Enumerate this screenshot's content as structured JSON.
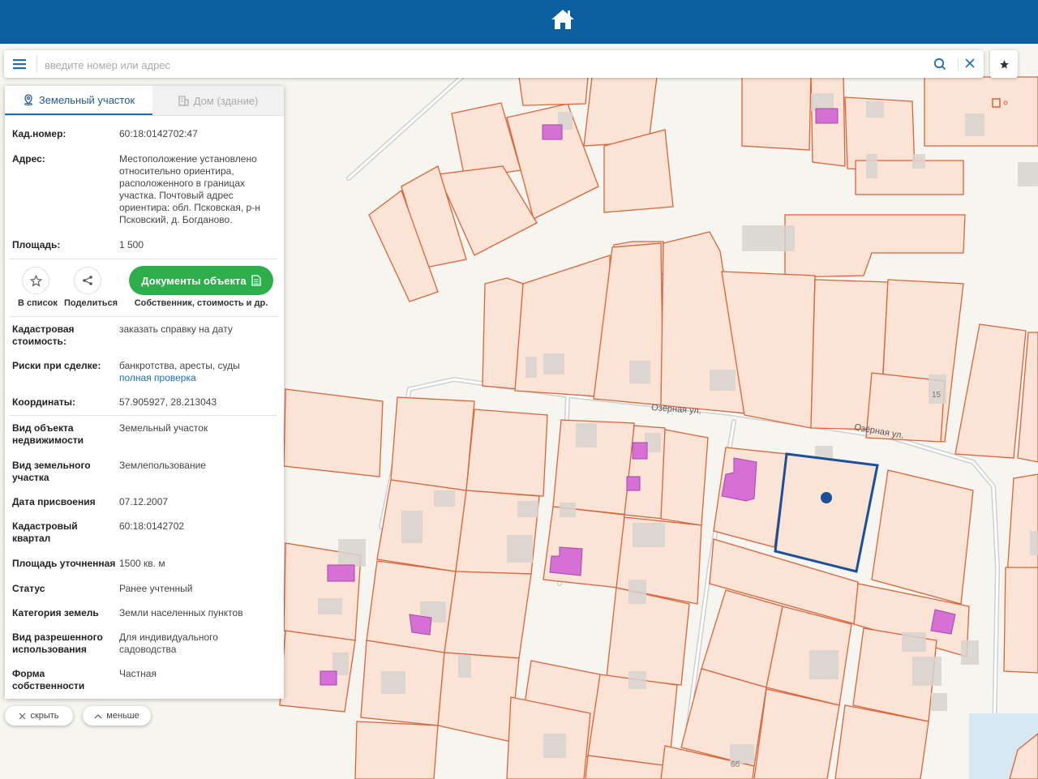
{
  "search": {
    "placeholder": "введите номер или адрес"
  },
  "tabs": {
    "land": "Земельный участок",
    "house": "Дом (здание)"
  },
  "parcel": {
    "cad_number_label": "Кад.номер:",
    "cad_number": "60:18:0142702:47",
    "address_label": "Адрес:",
    "address": "Местоположение установлено относительно ориентира, расположенного в границах участка. Почтовый адрес ориентира: обл. Псковская, р-н Псковский, д. Богданово.",
    "area_label": "Площадь:",
    "area": "1 500"
  },
  "actions": {
    "list_label": "В список",
    "share_label": "Поделиться",
    "docs_label": "Документы объекта",
    "docs_sub": "Собственник, стоимость и др."
  },
  "details": {
    "cost_label": "Кадастровая стоимость:",
    "cost_link": "заказать справку на дату",
    "risks_label": "Риски при сделке:",
    "risks_text": "банкротства, аресты, суды",
    "risks_link": "полная проверка",
    "coords_label": "Координаты:",
    "coords": "57.905927, 28.213043",
    "obj_type_label": "Вид объекта недвижимости",
    "obj_type": "Земельный участок",
    "land_type_label": "Вид земельного участка",
    "land_type": "Землепользование",
    "date_label": "Дата присвоения",
    "date": "07.12.2007",
    "quarter_label": "Кадастровый квартал",
    "quarter": "60:18:0142702",
    "area_precise_label": "Площадь уточненная",
    "area_precise": "1500 кв. м",
    "status_label": "Статус",
    "status": "Ранее учтенный",
    "category_label": "Категория земель",
    "category": "Земли населенных пунктов",
    "permitted_label": "Вид разрешенного использования",
    "permitted": "Для индивидуального садоводства",
    "ownership_label": "Форма собственности",
    "ownership": "Частная"
  },
  "bottom": {
    "hide": "скрыть",
    "less": "меньше"
  },
  "map": {
    "street_1": "Озёрная ул.",
    "street_2": "Озёрная ул.",
    "house_15": "15",
    "house_6b": "6б"
  },
  "colors": {
    "header": "#0a5f9f",
    "accent": "#1d6fb0",
    "docs_button": "#2eae4a",
    "parcel_stroke": "#d9643a",
    "parcel_fill": "#fbe3d6",
    "selected_parcel": "#1a4f99",
    "building": "#d66fd6"
  }
}
